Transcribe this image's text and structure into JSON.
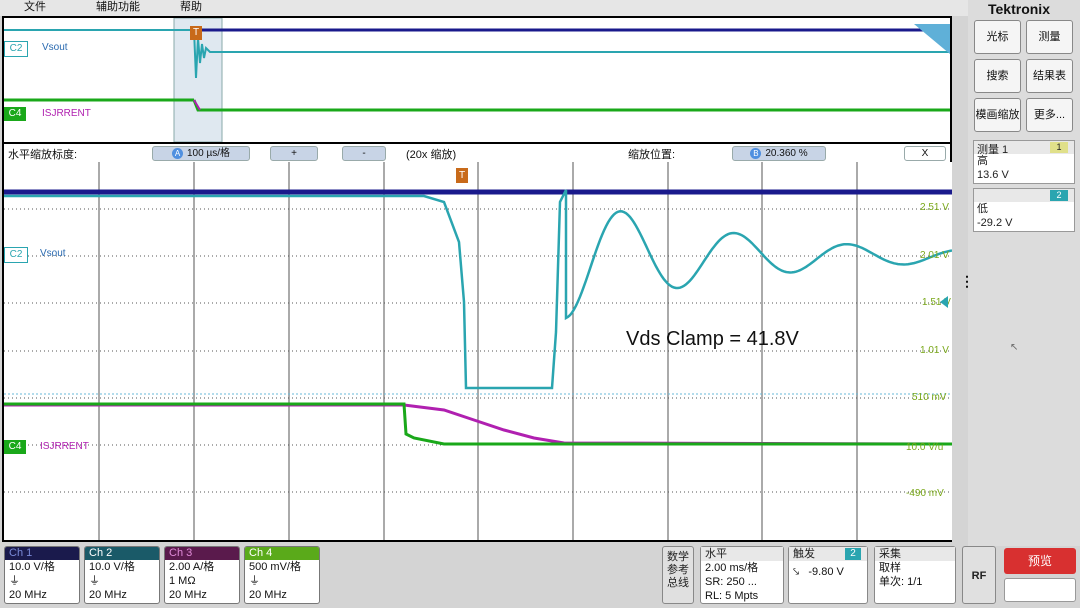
{
  "brand": "Tektronix",
  "menu": [
    "文件",
    "辅助功能",
    "帮助"
  ],
  "overview": {
    "ch2_label": "C2",
    "ch2_name": "Vsout",
    "ch4_label": "C4",
    "ch4_name": "ISJRRENT",
    "trigger_marker": "T"
  },
  "zoom": {
    "scale_label": "水平缩放标度:",
    "a_badge": "A",
    "scale_value": "100 µs/格",
    "plus": "+",
    "minus": "-",
    "zoom_factor": "(20x 缩放)",
    "position_label": "缩放位置:",
    "b_badge": "B",
    "position_value": "20.360 %",
    "close": "X"
  },
  "scope": {
    "ch2_label": "C2",
    "ch2_name": "Vsout",
    "ch4_label": "C4",
    "ch4_name": "ISJRRENT",
    "trigger_marker": "T",
    "annotation": "Vds Clamp = 41.8V",
    "ch4_ref_label": "10.0 V/u",
    "right_scale": [
      "2.51 V",
      "2.01 V",
      "1.51 V",
      "1.01 V",
      "510 mV",
      "-490 mV"
    ],
    "colors": {
      "ch1": "#1a1a8c",
      "ch2": "#2aa5b0",
      "ch3": "#b020b0",
      "ch4": "#1aa81a",
      "grid": "#555555",
      "scale_text": "#7aa81a"
    }
  },
  "right_panel": {
    "buttons": [
      "光标",
      "测量",
      "搜索",
      "结果表",
      "模画缩放",
      "更多..."
    ],
    "meas1": {
      "title": "测量 1",
      "badge": "1",
      "name": "高",
      "value": "13.6 V"
    },
    "meas2": {
      "badge": "2",
      "name": "低",
      "value": "-29.2 V"
    }
  },
  "channels": [
    {
      "name": "Ch 1",
      "line1": "10.0 V/格",
      "line3": "20 MHz",
      "color": "#1a1a6c",
      "text": "#7a8ad8"
    },
    {
      "name": "Ch 2",
      "line1": "10.0 V/格",
      "line3": "20 MHz",
      "color": "#1a6a78",
      "text": "#ffffff"
    },
    {
      "name": "Ch 3",
      "line1": "2.00 A/格",
      "line2": "1 MΩ",
      "line3": "20 MHz",
      "color": "#7a1a6a",
      "text": "#e08ad8"
    },
    {
      "name": "Ch 4",
      "line1": "500 mV/格",
      "line3": "20 MHz",
      "color": "#5aaa1a",
      "text": "#ffffff"
    }
  ],
  "math_ref_bus": "数学参考总线",
  "horizontal": {
    "title": "水平",
    "scale": "2.00 ms/格",
    "sr": "SR: 250 ...",
    "rl": "RL: 5 Mpts"
  },
  "trigger": {
    "title": "触发",
    "badge": "2",
    "level": "-9.80 V"
  },
  "acquire": {
    "title": "采集",
    "mode": "取样",
    "count": "单次: 1/1"
  },
  "rf": "RF",
  "preview": "预览"
}
